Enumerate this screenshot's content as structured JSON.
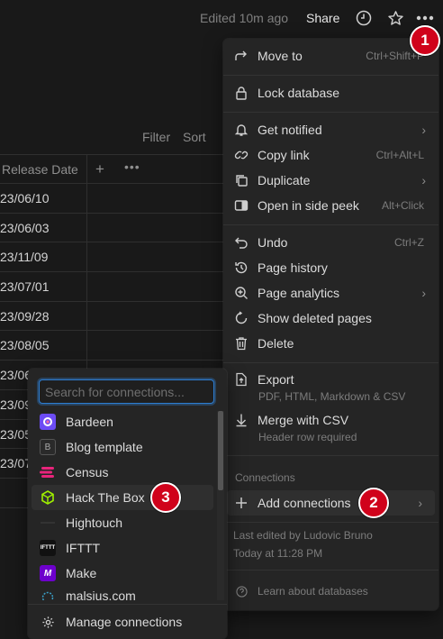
{
  "topbar": {
    "edited": "Edited 10m ago",
    "share": "Share"
  },
  "view": {
    "filter": "Filter",
    "sort": "Sort"
  },
  "table": {
    "column": "Release Date",
    "add": "+",
    "more": "•••",
    "rows": [
      "23/06/10",
      "23/06/03",
      "23/11/09",
      "23/07/01",
      "23/09/28",
      "23/08/05",
      "23/06",
      "23/09",
      "23/05",
      "23/07"
    ]
  },
  "main_menu": {
    "move_to": {
      "label": "Move to",
      "shortcut": "Ctrl+Shift+P"
    },
    "lock_database": {
      "label": "Lock database"
    },
    "get_notified": {
      "label": "Get notified"
    },
    "copy_link": {
      "label": "Copy link",
      "shortcut": "Ctrl+Alt+L"
    },
    "duplicate": {
      "label": "Duplicate"
    },
    "open_side_peek": {
      "label": "Open in side peek",
      "shortcut": "Alt+Click"
    },
    "undo": {
      "label": "Undo",
      "shortcut": "Ctrl+Z"
    },
    "page_history": {
      "label": "Page history"
    },
    "page_analytics": {
      "label": "Page analytics"
    },
    "show_deleted": {
      "label": "Show deleted pages"
    },
    "delete": {
      "label": "Delete"
    },
    "export": {
      "label": "Export",
      "sub": "PDF, HTML, Markdown & CSV"
    },
    "merge_csv": {
      "label": "Merge with CSV",
      "sub": "Header row required"
    },
    "connections_heading": "Connections",
    "add_connections": {
      "label": "Add connections"
    },
    "last_edited": "Last edited by Ludovic Bruno",
    "last_edited_time": "Today at 11:28 PM",
    "learn": "Learn about databases"
  },
  "connections_menu": {
    "search_placeholder": "Search for connections...",
    "items": [
      {
        "label": "Bardeen",
        "color": "#6c4cf5",
        "glyph": "●"
      },
      {
        "label": "Blog template",
        "color": "#2a2a2a",
        "glyph": "B"
      },
      {
        "label": "Census",
        "color": "#e8247b",
        "glyph": "≡"
      },
      {
        "label": "Hack The Box",
        "color": "#1f2a1a",
        "glyph": "⬡"
      },
      {
        "label": "Hightouch",
        "color": "#2a2a2a",
        "glyph": "—"
      },
      {
        "label": "IFTTT",
        "color": "#1a1a1a",
        "glyph": "ifttt"
      },
      {
        "label": "Make",
        "color": "#6d00cc",
        "glyph": "M"
      },
      {
        "label": "malsius.com",
        "color": "#1a1a1a",
        "glyph": "◎"
      }
    ],
    "manage": "Manage connections"
  },
  "badges": {
    "one": "1",
    "two": "2",
    "three": "3"
  },
  "colors": {
    "background": "#191919",
    "menu": "#252525",
    "accent": "#2d7dd2",
    "badge": "#d0021b"
  }
}
